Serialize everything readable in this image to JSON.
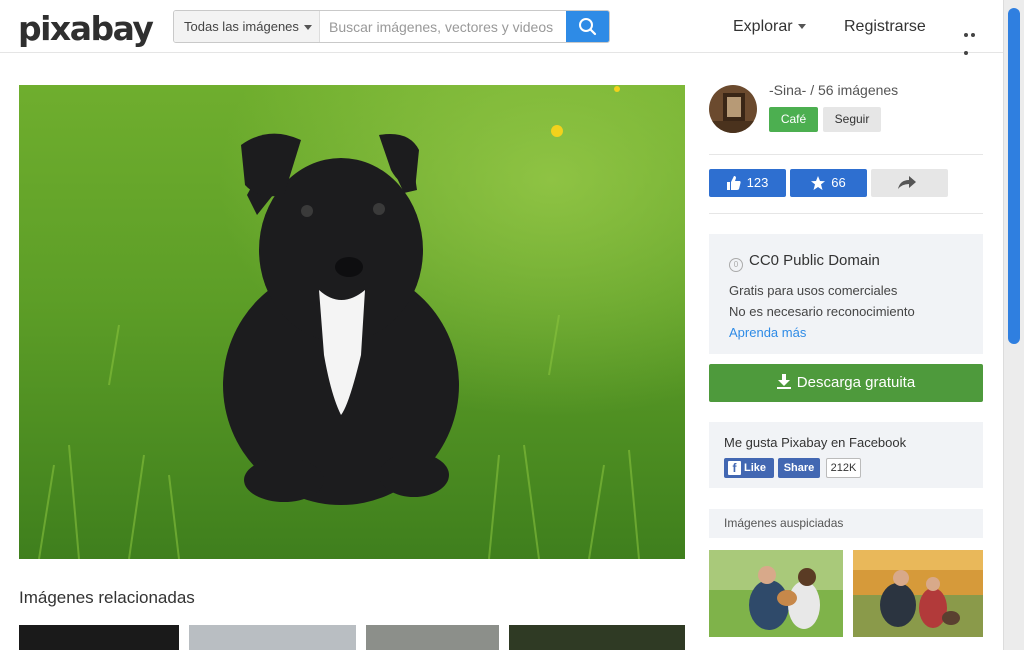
{
  "header": {
    "logo": "pixabay",
    "filter_label": "Todas las imágenes",
    "search_placeholder": "Buscar imágenes, vectores y videos",
    "nav_explore": "Explorar",
    "nav_register": "Registrarse"
  },
  "author": {
    "line": "-Sina- / 56 imágenes",
    "cafe_label": "Café",
    "follow_label": "Seguir"
  },
  "actions": {
    "likes": "123",
    "favorites": "66"
  },
  "license": {
    "title": "CC0 Public Domain",
    "line1": "Gratis para usos comerciales",
    "line2": "No es necesario reconocimiento",
    "link": "Aprenda más"
  },
  "download_label": "Descarga gratuita",
  "facebook": {
    "title": "Me gusta Pixabay en Facebook",
    "like": "Like",
    "share": "Share",
    "count": "212K"
  },
  "sponsored_title": "Imágenes auspiciadas",
  "related_title": "Imágenes relacionadas",
  "colors": {
    "accent_blue": "#2e8be6",
    "like_blue": "#2e6fd0",
    "download_green": "#4e9a3c",
    "cafe_green": "#4caf50"
  }
}
